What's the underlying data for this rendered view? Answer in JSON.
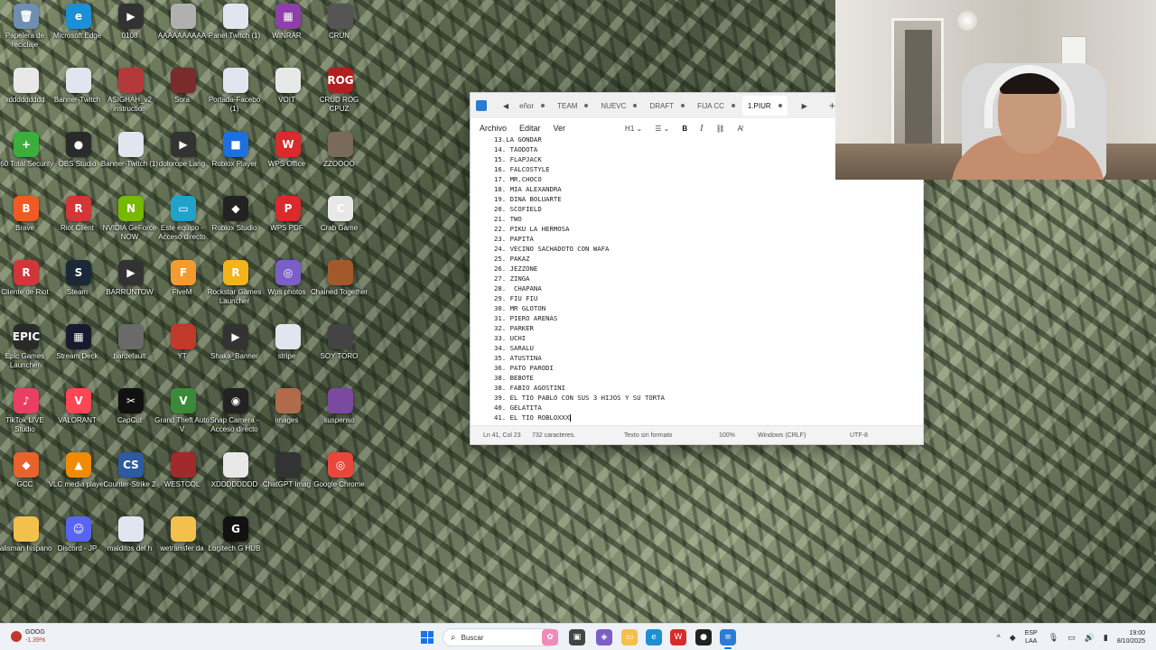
{
  "desktop": {
    "icons": [
      {
        "label": "Papelera de reciclaje",
        "glyph": "🗑",
        "color": "#6f8fb0"
      },
      {
        "label": "Microsoft Edge",
        "glyph": "e",
        "color": "#1d8fd6"
      },
      {
        "label": "0108",
        "glyph": "▶",
        "color": "#333333"
      },
      {
        "label": "AAAAAAAAAA",
        "glyph": "",
        "color": "#b0b0b0"
      },
      {
        "label": "Panel Twitch (1)",
        "glyph": "",
        "color": "#dfe6f0"
      },
      {
        "label": "WINRAR",
        "glyph": "▦",
        "color": "#8e3fa8"
      },
      {
        "label": "CRUN",
        "glyph": "",
        "color": "#555555"
      },
      {
        "label": "xddddddddd",
        "glyph": "",
        "color": "#e8e8e8"
      },
      {
        "label": "Banner-Twitch",
        "glyph": "",
        "color": "#dfe6f0"
      },
      {
        "label": "ASIGHAH_v2 instruction",
        "glyph": "",
        "color": "#b33a3a"
      },
      {
        "label": "Sora",
        "glyph": "",
        "color": "#7a2b2b"
      },
      {
        "label": "Portada-Facebo (1)",
        "glyph": "",
        "color": "#dfe6f0"
      },
      {
        "label": "VOIT",
        "glyph": "",
        "color": "#e8e8e8"
      },
      {
        "label": "CRUD ROG CPUZ",
        "glyph": "ROG",
        "color": "#b21f1f"
      },
      {
        "label": "360 Total Security",
        "glyph": "+",
        "color": "#3cae3c"
      },
      {
        "label": "OBS Studio",
        "glyph": "●",
        "color": "#2a2a2a"
      },
      {
        "label": "Banner-Twitch (1)",
        "glyph": "",
        "color": "#dfe6f0"
      },
      {
        "label": "dolorope Lang",
        "glyph": "▶",
        "color": "#333333"
      },
      {
        "label": "Roblox Player",
        "glyph": "■",
        "color": "#1e6fe0"
      },
      {
        "label": "WPS Office",
        "glyph": "W",
        "color": "#d92b2b"
      },
      {
        "label": "ZZOOOO",
        "glyph": "",
        "color": "#7a6a5a"
      },
      {
        "label": "Brave",
        "glyph": "B",
        "color": "#f05a24"
      },
      {
        "label": "Riot Client",
        "glyph": "R",
        "color": "#d13639"
      },
      {
        "label": "NVIDIA GeForce NOW",
        "glyph": "N",
        "color": "#76b900"
      },
      {
        "label": "Este equipo - Acceso directo",
        "glyph": "▭",
        "color": "#1fa3c9"
      },
      {
        "label": "Roblox Studio",
        "glyph": "◆",
        "color": "#222222"
      },
      {
        "label": "WPS PDF",
        "glyph": "P",
        "color": "#d92b2b"
      },
      {
        "label": "Crab Game",
        "glyph": "C",
        "color": "#e8e8e8"
      },
      {
        "label": "Cliente de Riot",
        "glyph": "R",
        "color": "#d13639"
      },
      {
        "label": "Steam",
        "glyph": "S",
        "color": "#1b2838"
      },
      {
        "label": "BARRUNTOW",
        "glyph": "▶",
        "color": "#333333"
      },
      {
        "label": "FiveM",
        "glyph": "F",
        "color": "#f29b30"
      },
      {
        "label": "Rockstar Games Launcher",
        "glyph": "R",
        "color": "#f3b31b"
      },
      {
        "label": "Wps photos",
        "glyph": "◎",
        "color": "#7b5fc6"
      },
      {
        "label": "Chained Together",
        "glyph": "",
        "color": "#a35a2a"
      },
      {
        "label": "Epic Games Launcher",
        "glyph": "EPIC",
        "color": "#2a2a2a"
      },
      {
        "label": "Stream Deck",
        "glyph": "▦",
        "color": "#1a1a2e"
      },
      {
        "label": "bardefault",
        "glyph": "",
        "color": "#6a6a6a"
      },
      {
        "label": "YT",
        "glyph": "",
        "color": "#c0392b"
      },
      {
        "label": "Shaka_Banner",
        "glyph": "▶",
        "color": "#333333"
      },
      {
        "label": "stripe",
        "glyph": "",
        "color": "#dfe6f0"
      },
      {
        "label": "SOY TORO",
        "glyph": "",
        "color": "#444444"
      },
      {
        "label": "TikTok LIVE Studio",
        "glyph": "♪",
        "color": "#e93f66"
      },
      {
        "label": "VALORANT",
        "glyph": "V",
        "color": "#ff4655"
      },
      {
        "label": "CapCut",
        "glyph": "✂",
        "color": "#111111"
      },
      {
        "label": "Grand Theft Auto V",
        "glyph": "V",
        "color": "#3a8a3a"
      },
      {
        "label": "Snap Camera - Acceso directo",
        "glyph": "◉",
        "color": "#222222"
      },
      {
        "label": "images",
        "glyph": "",
        "color": "#b06b4a"
      },
      {
        "label": "suspenso",
        "glyph": "",
        "color": "#7a4aa0"
      },
      {
        "label": "GCC",
        "glyph": "◆",
        "color": "#e8632b"
      },
      {
        "label": "VLC media player",
        "glyph": "▲",
        "color": "#f08a00"
      },
      {
        "label": "Counter-Strike 2",
        "glyph": "CS",
        "color": "#2d5aa0"
      },
      {
        "label": "WESTCOL",
        "glyph": "",
        "color": "#a02a2a"
      },
      {
        "label": "XDDDDDDDD",
        "glyph": "",
        "color": "#e8e8e8"
      },
      {
        "label": "ChatGPT Imag",
        "glyph": "",
        "color": "#333333"
      },
      {
        "label": "Google Chrome",
        "glyph": "◎",
        "color": "#e9473c"
      },
      {
        "label": "talisman hispano",
        "glyph": "",
        "color": "#f3c14b"
      },
      {
        "label": "Discord - JP",
        "glyph": "☺",
        "color": "#5865f2"
      },
      {
        "label": "malditos del h",
        "glyph": "",
        "color": "#dfe6f0"
      },
      {
        "label": "wetransfer da",
        "glyph": "",
        "color": "#f3c14b"
      },
      {
        "label": "Logitech G HUB",
        "glyph": "G",
        "color": "#111111"
      }
    ]
  },
  "notepad": {
    "tabs": [
      {
        "label": "eñor"
      },
      {
        "label": "TEAM"
      },
      {
        "label": "NUEVC"
      },
      {
        "label": "DRAFT"
      },
      {
        "label": "FIJA CC"
      },
      {
        "label": "1.PIUR",
        "active": true
      }
    ],
    "menu": [
      "Archivo",
      "Editar",
      "Ver"
    ],
    "format_heading": "H1",
    "lines": [
      "13.LA GONDAR",
      "14. TAODOTA",
      "15. FLAPJACK",
      "16. FALCOSTYLE",
      "17. MR.CHOCO",
      "18. MIA ALEXANDRA",
      "19. DINA BOLUARTE",
      "20. SCOFIELD",
      "21. TWO",
      "22. PIKU LA HERMOSA",
      "23. PAPITA",
      "24. VECINO SACHADOTO CON WAFA",
      "25. PAKAZ",
      "26. JEZZONE",
      "27. ZINGA",
      "28.  CHAPANA",
      "29. FIU FIU",
      "30. MR GLOTON",
      "31. PIERO ARENAS",
      "32. PARKER",
      "33. UCHI",
      "34. SARALU",
      "35. ATUSTINA",
      "36. PATO PARODI",
      "38. BEBOTE",
      "38. FABIO AGOSTINI",
      "39. EL TIO PABLO CON SUS 3 HIJOS Y SU TORTA",
      "40. GELATITA",
      "41. EL TIO ROBLOXXX"
    ],
    "status": {
      "position": "Ln 41, Col 23",
      "chars": "732 caracteres.",
      "format": "Texto sin formato",
      "zoom": "100%",
      "line_ending": "Windows (CRLF)",
      "encoding": "UTF-8"
    }
  },
  "taskbar": {
    "widget_ticker": "GOOG",
    "widget_change": "-1.39%",
    "search_placeholder": "Buscar",
    "lang_top": "ESP",
    "lang_bottom": "LAA",
    "time": "19:00",
    "date": "8/10/2025"
  }
}
